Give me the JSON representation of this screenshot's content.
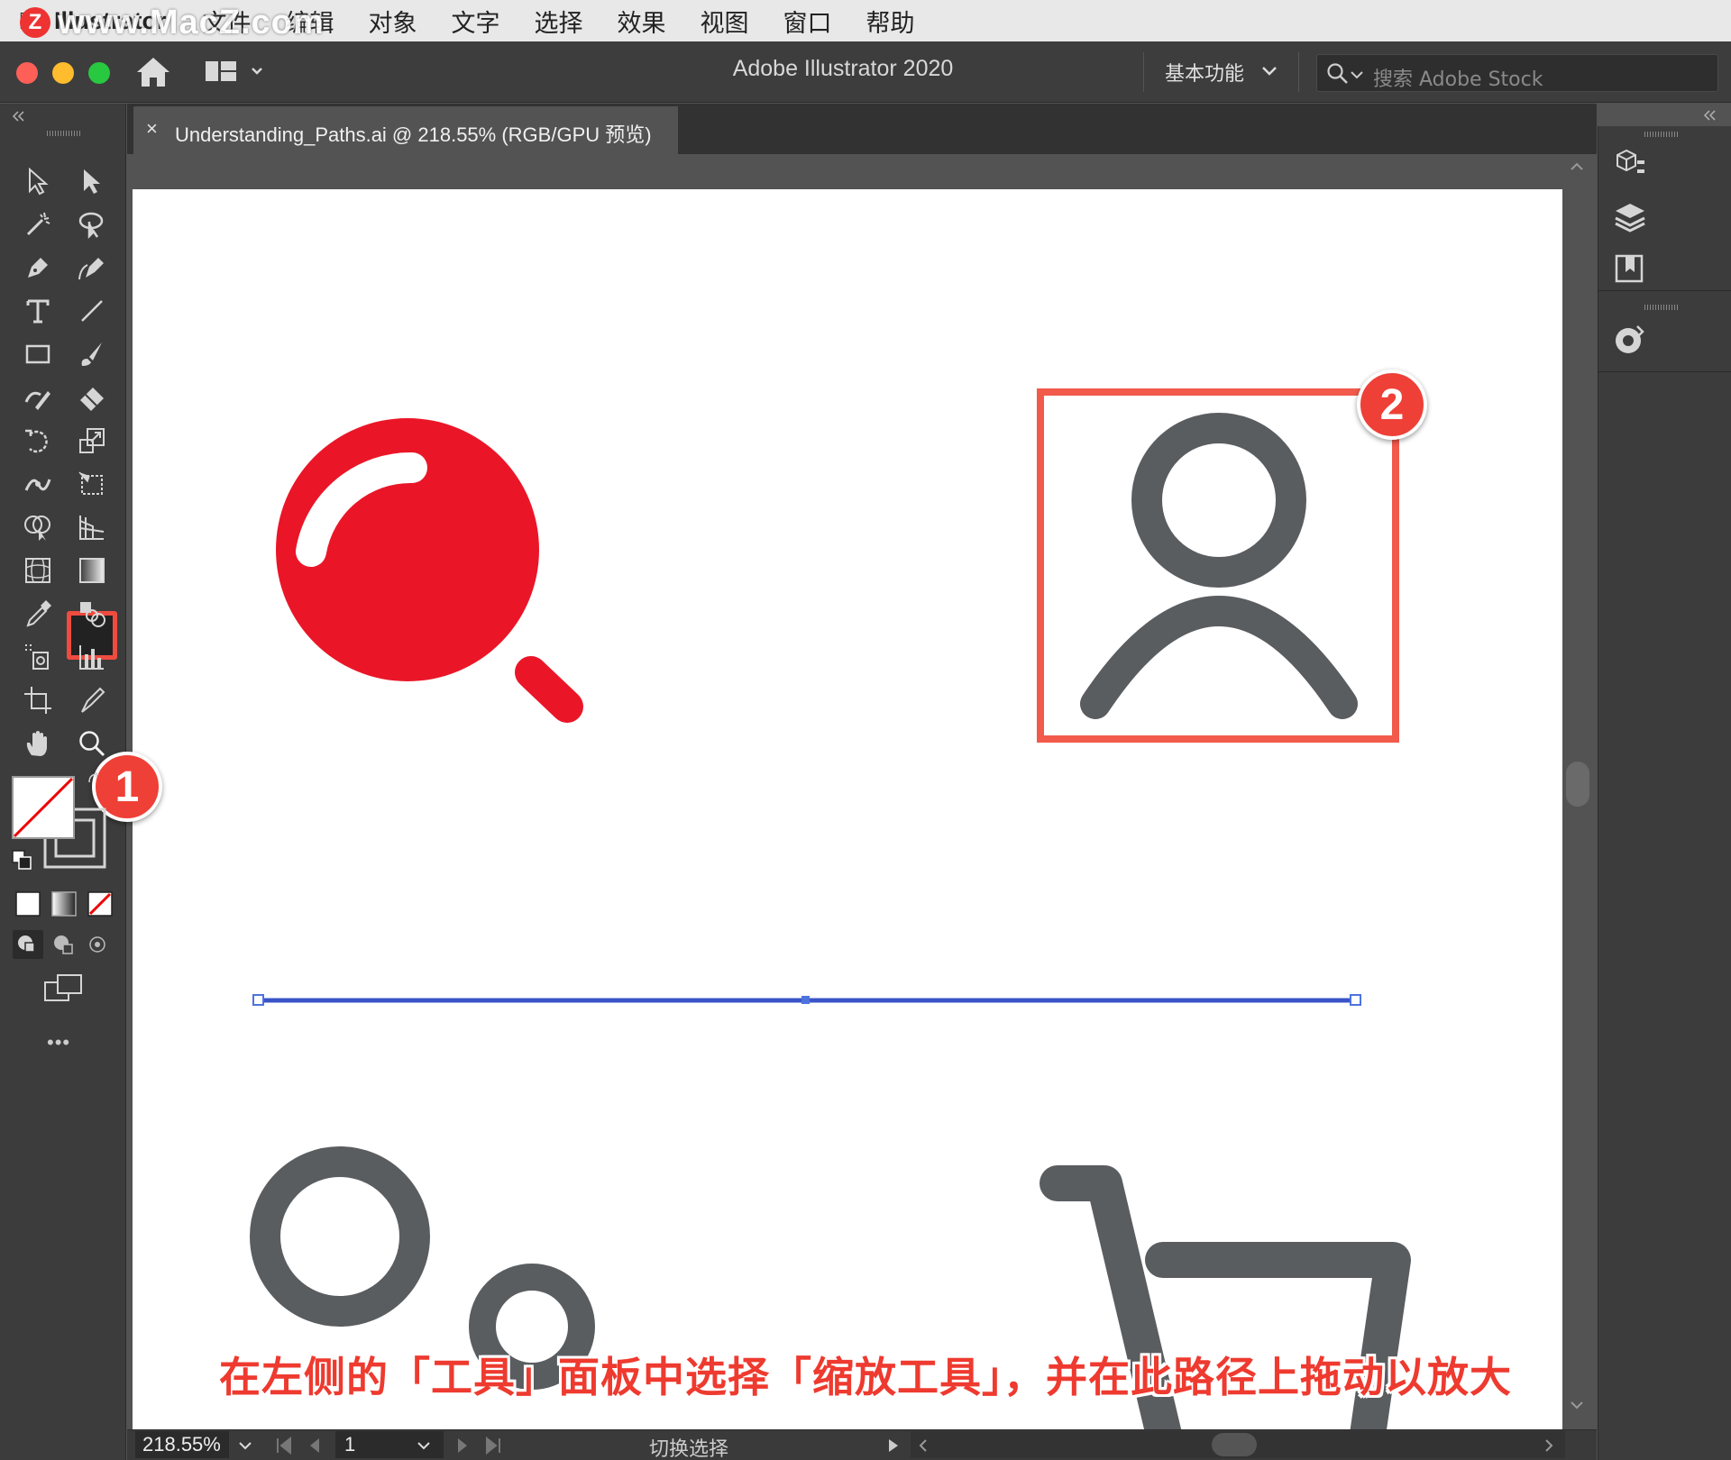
{
  "menubar": {
    "app_name": "Illustrator",
    "items": [
      "文件",
      "编辑",
      "对象",
      "文字",
      "选择",
      "效果",
      "视图",
      "窗口",
      "帮助"
    ],
    "watermark": "www.MacZ.com",
    "watermark_logo": "Z"
  },
  "titlebar": {
    "app_title": "Adobe Illustrator 2020",
    "workspace": "基本功能",
    "search_placeholder": "搜索 Adobe Stock",
    "icons": [
      "home-icon",
      "arrange-documents-icon",
      "search-icon"
    ]
  },
  "document_tab": {
    "close": "×",
    "title": "Understanding_Paths.ai @ 218.55% (RGB/GPU 预览)"
  },
  "tools": [
    "selection-tool",
    "direct-selection-tool",
    "magic-wand-tool",
    "lasso-tool",
    "pen-tool",
    "curvature-tool",
    "type-tool",
    "line-segment-tool",
    "rectangle-tool",
    "paintbrush-tool",
    "shaper-tool",
    "eraser-tool",
    "rotate-tool",
    "scale-tool",
    "width-tool",
    "free-transform-tool",
    "shape-builder-tool",
    "perspective-grid-tool",
    "mesh-tool",
    "gradient-tool",
    "eyedropper-tool",
    "blend-tool",
    "symbol-sprayer-tool",
    "column-graph-tool",
    "artboard-tool",
    "slice-tool",
    "hand-tool",
    "zoom-tool"
  ],
  "more_tools": "•••",
  "callouts": {
    "badge_1": "1",
    "badge_2": "2"
  },
  "colors": {
    "accent_red": "#ee4037",
    "icon_gray": "#5a5d60",
    "magnifier_red": "#ea1628",
    "path_blue": "#3a54c8"
  },
  "statusbar": {
    "zoom": "218.55%",
    "artboard_number": "1",
    "toggle_label": "切换选择"
  },
  "subtitle": "在左侧的「工具」面板中选择「缩放工具」，并在此路径上拖动以放大"
}
